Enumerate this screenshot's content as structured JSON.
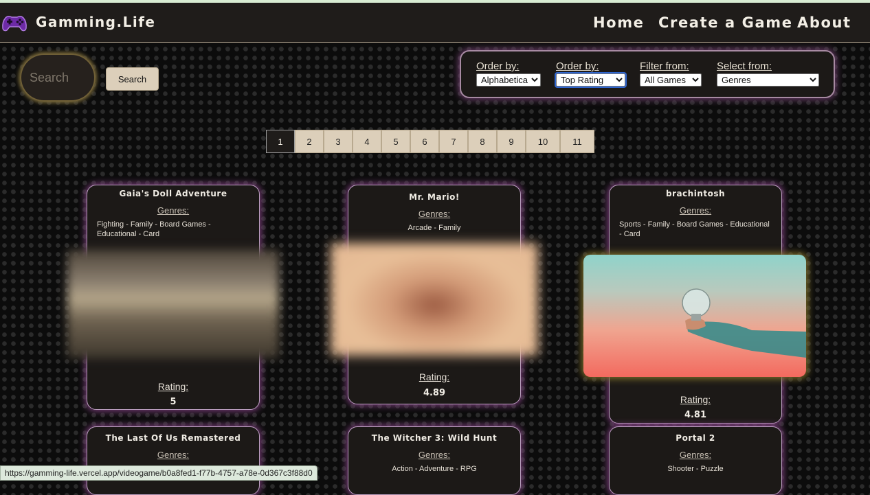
{
  "header": {
    "brand": "Gamming.Life",
    "logo_icon": "gamepad-icon",
    "nav": [
      "Home",
      "Create a Game",
      "About"
    ]
  },
  "search": {
    "placeholder": "Search",
    "button_label": "Search"
  },
  "filters": [
    {
      "label": "Order by:",
      "selected": "Alphabetical"
    },
    {
      "label": "Order by:",
      "selected": "Top Rating"
    },
    {
      "label": "Filter from:",
      "selected": "All Games"
    },
    {
      "label": "Select from:",
      "selected": "Genres"
    }
  ],
  "pagination": {
    "pages": [
      "1",
      "2",
      "3",
      "4",
      "5",
      "6",
      "7",
      "8",
      "9",
      "10",
      "11"
    ],
    "current": "1"
  },
  "games": [
    {
      "title": "Gaia's Doll Adventure",
      "genres_label": "Genres:",
      "genres": "Fighting - Family - Board Games - Educational - Card",
      "rating_label": "Rating:",
      "rating": "5"
    },
    {
      "title": "Mr. Mario!",
      "genres_label": "Genres:",
      "genres": "Arcade - Family",
      "rating_label": "Rating:",
      "rating": "4.89"
    },
    {
      "title": "brachintosh",
      "genres_label": "Genres:",
      "genres": "Sports - Family - Board Games - Educational - Card",
      "rating_label": "Rating:",
      "rating": "4.81"
    },
    {
      "title": "The Last Of Us Remastered",
      "genres_label": "Genres:",
      "genres": ""
    },
    {
      "title": "The Witcher 3: Wild Hunt",
      "genres_label": "Genres:",
      "genres": "Action - Adventure - RPG"
    },
    {
      "title": "Portal 2",
      "genres_label": "Genres:",
      "genres": "Shooter - Puzzle"
    }
  ],
  "status_url": "https://gamming-life.vercel.app/videogame/b0a8fed1-f77b-4757-a78e-0d367c3f88d0",
  "colors": {
    "accent_glow": "#7a3f7a",
    "button_bg": "#dccfba",
    "header_bg": "#1f1c1a"
  }
}
